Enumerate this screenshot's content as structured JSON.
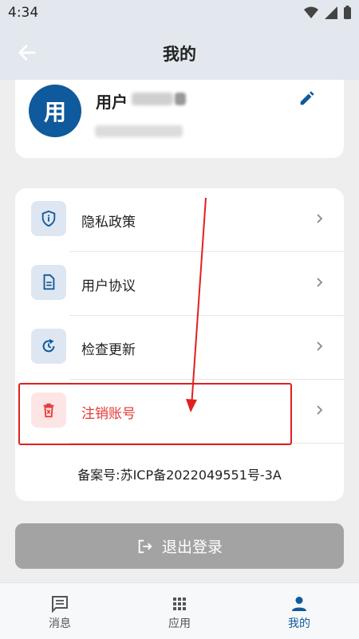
{
  "status_bar": {
    "time": "4:34",
    "icons": [
      "wifi-icon",
      "signal-icon",
      "battery-icon"
    ]
  },
  "app_bar": {
    "title": "我的",
    "back_icon": "arrow-left-icon"
  },
  "profile": {
    "avatar_text": "用",
    "name_prefix": "用户",
    "edit_icon": "pencil-icon"
  },
  "menu": {
    "items": [
      {
        "label": "隐私政策",
        "icon": "shield-info-icon"
      },
      {
        "label": "用户协议",
        "icon": "document-icon"
      },
      {
        "label": "检查更新",
        "icon": "refresh-icon"
      },
      {
        "label": "注销账号",
        "icon": "trash-icon"
      }
    ],
    "icp": "备案号:苏ICP备2022049551号-3A"
  },
  "logout": {
    "label": "退出登录",
    "icon": "logout-icon"
  },
  "bottom_nav": {
    "items": [
      {
        "label": "消息",
        "icon": "message-icon",
        "active": false
      },
      {
        "label": "应用",
        "icon": "grid-icon",
        "active": false
      },
      {
        "label": "我的",
        "icon": "person-icon",
        "active": true
      }
    ]
  },
  "colors": {
    "accent": "#0f5a9c",
    "danger": "#e53935",
    "annotation": "#e02020",
    "icon_box": "#dde6f1",
    "logout_bg": "#a3a3a3"
  }
}
